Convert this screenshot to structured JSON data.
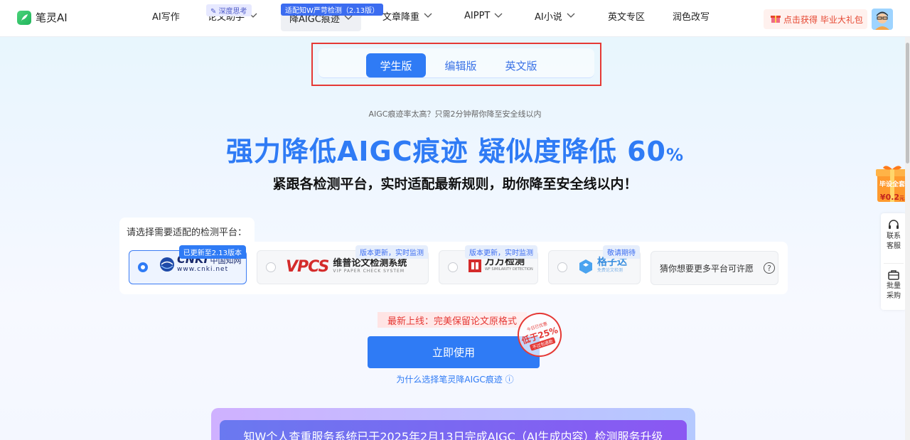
{
  "header": {
    "logo_text": "笔灵AI",
    "nav": [
      {
        "label": "AI写作",
        "has_dropdown": false
      },
      {
        "label": "论文助手",
        "has_dropdown": true,
        "badge": "深度思考"
      },
      {
        "label": "降AIGC痕迹",
        "has_dropdown": true,
        "badge": "适配知W严苛检测（2.13版）",
        "active": true
      },
      {
        "label": "文章降重",
        "has_dropdown": true
      },
      {
        "label": "AIPPT",
        "has_dropdown": true
      },
      {
        "label": "AI小说",
        "has_dropdown": true
      },
      {
        "label": "英文专区",
        "has_dropdown": false
      },
      {
        "label": "润色改写",
        "has_dropdown": false
      }
    ],
    "promo_label": "点击获得 毕业大礼包"
  },
  "tabs": [
    {
      "label": "学生版",
      "active": true
    },
    {
      "label": "编辑版",
      "active": false
    },
    {
      "label": "英文版",
      "active": false
    }
  ],
  "hero": {
    "subtitle": "AIGC痕迹率太高？只需2分钟帮你降至安全线以内",
    "title_main": "强力降低AIGC痕迹 疑似度降低 60",
    "title_pct": "%",
    "description": "紧跟各检测平台，实时适配最新规则，助你降至安全线以内！"
  },
  "platform": {
    "label": "请选择需要适配的检测平台：",
    "options": [
      {
        "name": "cnki",
        "logo_text": "CNKI",
        "logo_cn": "中国知网",
        "logo_url_text": "www.cnki.net",
        "tag": "已更新至2.13版本",
        "selected": true
      },
      {
        "name": "vpcs",
        "logo_text": "VPCS",
        "logo_cn": "维普论文检测系统",
        "logo_sub": "VIP PAPER CHECK SYSTEM",
        "tag": "版本更新，实时监测",
        "selected": false
      },
      {
        "name": "wanfang",
        "logo_cn": "万方检测",
        "logo_sub": "WF SIMILARITY DETECTION",
        "tag": "版本更新，实时监测",
        "selected": false
      },
      {
        "name": "gezida",
        "logo_cn": "格子达",
        "logo_sub": "免费论文检测",
        "tag": "敬请期待",
        "selected": false
      }
    ],
    "wish_label": "猜你想要更多平台可许愿",
    "wish_icon": "?"
  },
  "cta": {
    "new_online": "最新上线：完美保留论文原格式",
    "button": "立即使用",
    "stamp_top": "今日已优惠",
    "stamp_main": "低于25%",
    "stamp_bottom": "不过包退款",
    "why_link": "为什么选择笔灵降AIGC痕迹"
  },
  "notice": {
    "text": "知W个人查重服务系统已于2025年2月13日完成AIGC（AI生成内容）检测服务升级"
  },
  "side": {
    "gift_top": "毕设全套",
    "gift_price": "¥0.2",
    "gift_unit": "元",
    "contact": [
      "联系",
      "客服"
    ],
    "bulk": [
      "批量",
      "采购"
    ]
  },
  "colors": {
    "primary": "#2F7BF5",
    "highlight_border": "#E53935",
    "promo_red": "#E5452F"
  }
}
